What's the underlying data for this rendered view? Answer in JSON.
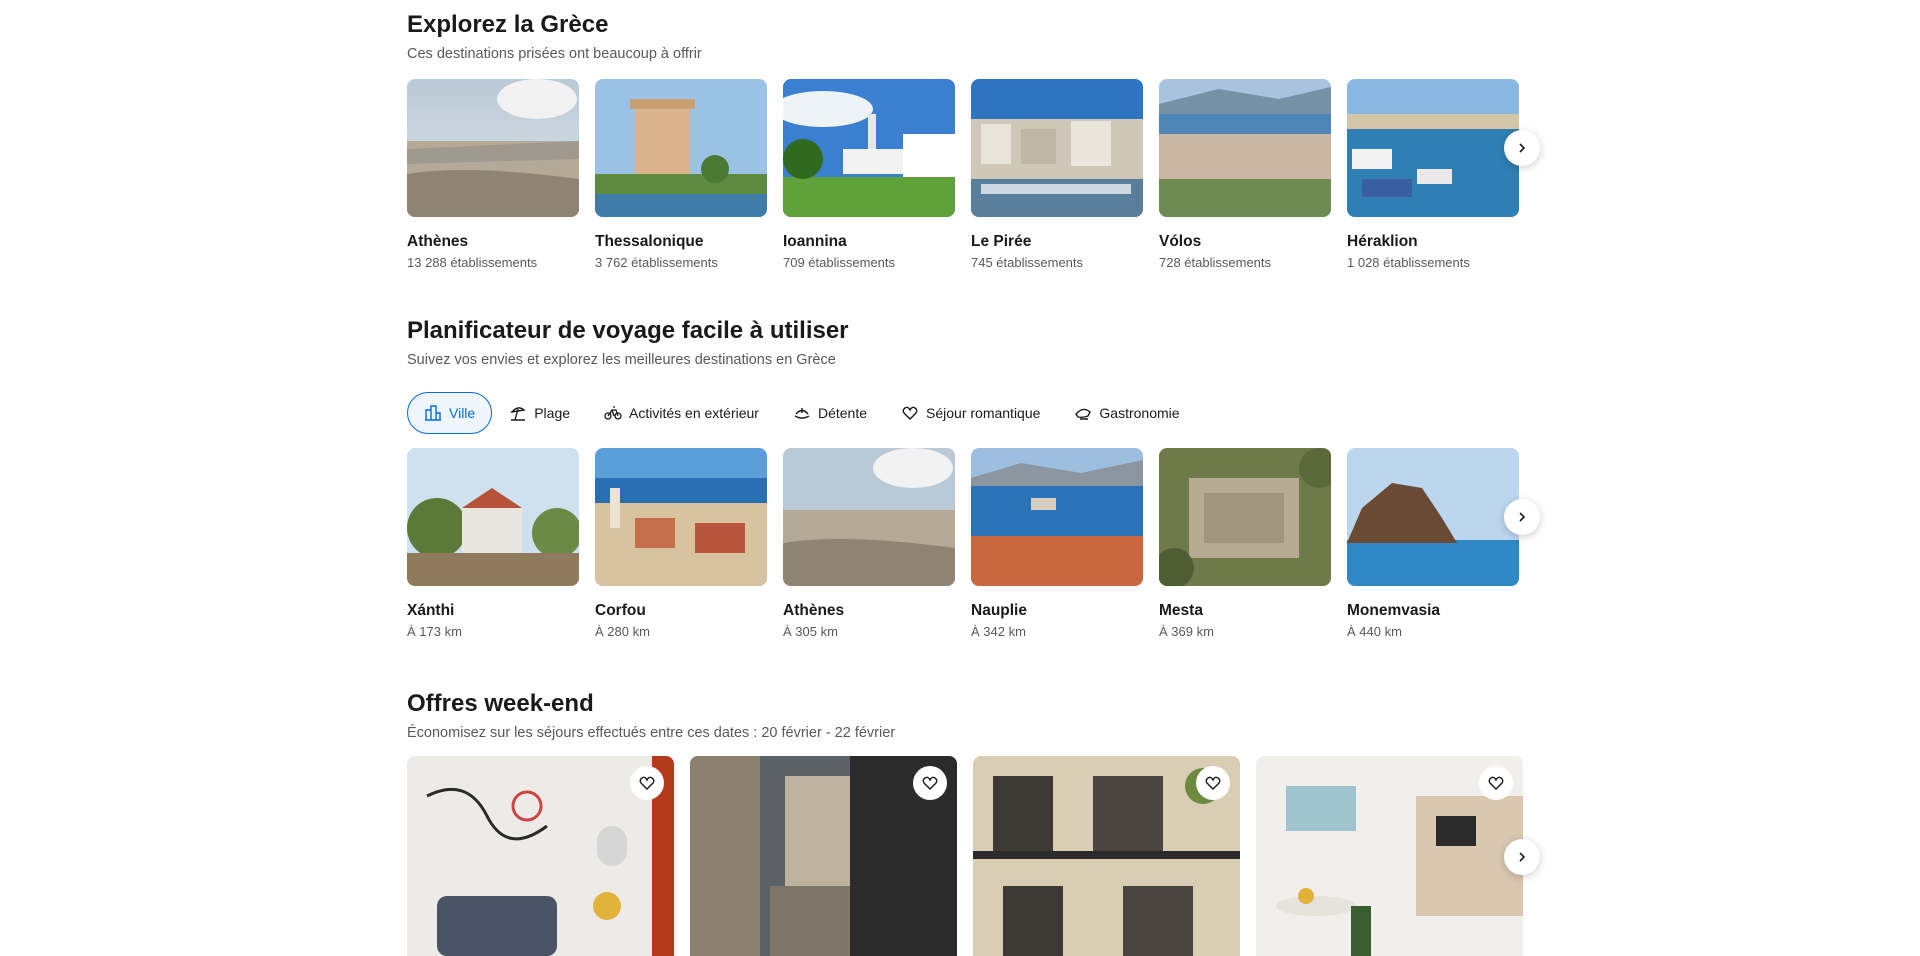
{
  "explore": {
    "title": "Explorez la Grèce",
    "subtitle": "Ces destinations prisées ont beaucoup à offrir",
    "destinations": [
      {
        "name": "Athènes",
        "meta": "13 288 établissements"
      },
      {
        "name": "Thessalonique",
        "meta": "3 762 établissements"
      },
      {
        "name": "Ioannina",
        "meta": "709 établissements"
      },
      {
        "name": "Le Pirée",
        "meta": "745 établissements"
      },
      {
        "name": "Vólos",
        "meta": "728 établissements"
      },
      {
        "name": "Héraklion",
        "meta": "1 028 établissements"
      }
    ]
  },
  "planner": {
    "title": "Planificateur de voyage facile à utiliser",
    "subtitle": "Suivez vos envies et explorez les meilleures destinations en Grèce",
    "chips": [
      {
        "label": "Ville",
        "icon": "city-icon",
        "active": true
      },
      {
        "label": "Plage",
        "icon": "beach-icon",
        "active": false
      },
      {
        "label": "Activités en extérieur",
        "icon": "bicycle-icon",
        "active": false
      },
      {
        "label": "Détente",
        "icon": "spa-icon",
        "active": false
      },
      {
        "label": "Séjour romantique",
        "icon": "heart-icon",
        "active": false
      },
      {
        "label": "Gastronomie",
        "icon": "food-icon",
        "active": false
      }
    ],
    "destinations": [
      {
        "name": "Xánthi",
        "meta": "À 173 km"
      },
      {
        "name": "Corfou",
        "meta": "À 280 km"
      },
      {
        "name": "Athènes",
        "meta": "À 305 km"
      },
      {
        "name": "Nauplie",
        "meta": "À 342 km"
      },
      {
        "name": "Mesta",
        "meta": "À 369 km"
      },
      {
        "name": "Monemvasia",
        "meta": "À 440 km"
      }
    ]
  },
  "weekend": {
    "title": "Offres week-end",
    "subtitle": "Économisez sur les séjours effectués entre ces dates : 20 février - 22 février"
  },
  "colors": {
    "accent": "#006ce4",
    "text": "#1a1a1a",
    "muted": "#595959"
  }
}
